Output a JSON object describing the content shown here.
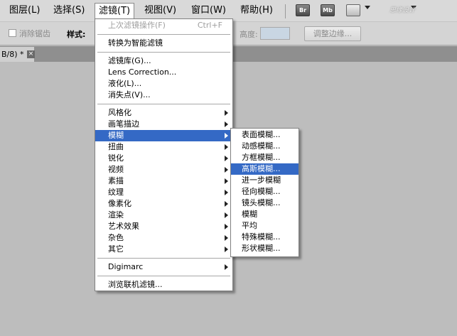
{
  "menubar": {
    "items": [
      {
        "label": "图层(L)"
      },
      {
        "label": "选择(S)"
      },
      {
        "label": "滤镜(T)"
      },
      {
        "label": "视图(V)"
      },
      {
        "label": "窗口(W)"
      },
      {
        "label": "帮助(H)"
      }
    ],
    "buttons": {
      "bridge": "Br",
      "minibridge": "Mb"
    },
    "watermark": "思缘设计"
  },
  "options": {
    "feather_label": "消除锯齿",
    "style_label": "样式:",
    "height_label": "高度:",
    "refine_button": "调整边缘..."
  },
  "document": {
    "tab_label": "B/8) *",
    "close_glyph": "×"
  },
  "filter_menu": {
    "items": [
      {
        "label": "上次滤镜操作(F)",
        "shortcut": "Ctrl+F"
      },
      {
        "label": "转换为智能滤镜"
      },
      {
        "label": "滤镜库(G)..."
      },
      {
        "label": "Lens Correction..."
      },
      {
        "label": "液化(L)..."
      },
      {
        "label": "消失点(V)..."
      },
      {
        "label": "风格化"
      },
      {
        "label": "画笔描边"
      },
      {
        "label": "模糊"
      },
      {
        "label": "扭曲"
      },
      {
        "label": "锐化"
      },
      {
        "label": "视频"
      },
      {
        "label": "素描"
      },
      {
        "label": "纹理"
      },
      {
        "label": "像素化"
      },
      {
        "label": "渲染"
      },
      {
        "label": "艺术效果"
      },
      {
        "label": "杂色"
      },
      {
        "label": "其它"
      },
      {
        "label": "Digimarc"
      },
      {
        "label": "浏览联机滤镜..."
      }
    ]
  },
  "blur_menu": {
    "items": [
      {
        "label": "表面模糊..."
      },
      {
        "label": "动感模糊..."
      },
      {
        "label": "方框模糊..."
      },
      {
        "label": "高斯模糊..."
      },
      {
        "label": "进一步模糊"
      },
      {
        "label": "径向模糊..."
      },
      {
        "label": "镜头模糊..."
      },
      {
        "label": "模糊"
      },
      {
        "label": "平均"
      },
      {
        "label": "特殊模糊..."
      },
      {
        "label": "形状模糊..."
      }
    ]
  },
  "colors": {
    "highlight": "#3469c5"
  }
}
